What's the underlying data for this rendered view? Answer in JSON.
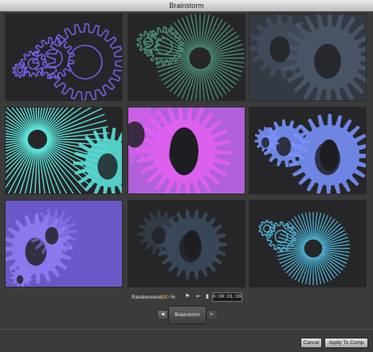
{
  "window": {
    "title": "Brainstorm"
  },
  "variations": [
    {
      "id": "variation-1",
      "background": "#262628",
      "color": "#7060e0"
    },
    {
      "id": "variation-2",
      "background": "#262628",
      "color": "#4a8a78"
    },
    {
      "id": "variation-3",
      "background": "#343a44",
      "color": "#4a5668"
    },
    {
      "id": "variation-4",
      "background": "#262628",
      "color": "#5ae0d8"
    },
    {
      "id": "variation-5",
      "background": "#b060d8",
      "color": "#e060f0"
    },
    {
      "id": "variation-6",
      "background": "#262628",
      "color": "#7890f8"
    },
    {
      "id": "variation-7",
      "background": "#6a58c8",
      "color": "#8e7cf0"
    },
    {
      "id": "variation-8",
      "background": "#262628",
      "color": "#3c4a5c"
    },
    {
      "id": "variation-9",
      "background": "#262628",
      "color": "#4aa8c8"
    }
  ],
  "controls": {
    "randomness_label": "Randomness:",
    "randomness_value": "100",
    "randomness_unit": "%",
    "timecode": "0:00:01:09",
    "icons": [
      "flag-icon",
      "step-back-icon",
      "pin-icon"
    ]
  },
  "brainstorm": {
    "button_label": "Brainstorm",
    "back_icon": "back-arrow-icon",
    "forward_icon": "forward-arrow-icon"
  },
  "footer": {
    "cancel_label": "Cancel",
    "apply_label": "Apply To Comp"
  }
}
